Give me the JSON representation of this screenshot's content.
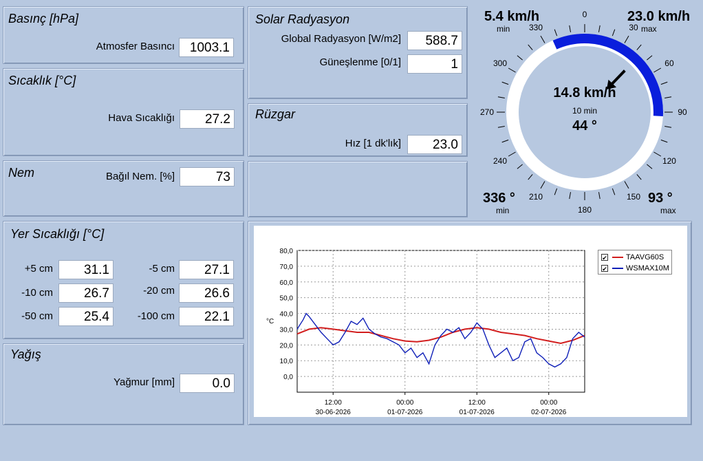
{
  "pressure": {
    "title": "Basınç [hPa]",
    "label": "Atmosfer Basıncı",
    "value": "1003.1"
  },
  "temperature": {
    "title": "Sıcaklık [°C]",
    "label": "Hava Sıcaklığı",
    "value": "27.2"
  },
  "humidity": {
    "title": "Nem",
    "label": "Bağıl Nem. [%]",
    "value": "73"
  },
  "soil": {
    "title": "Yer Sıcaklığı [°C]",
    "rows": [
      {
        "l_label": "+5 cm",
        "l_value": "31.1",
        "r_label": "-5 cm",
        "r_value": "27.1"
      },
      {
        "l_label": "-10 cm",
        "l_value": "26.7",
        "r_label": "-20 cm",
        "r_value": "26.6"
      },
      {
        "l_label": "-50 cm",
        "l_value": "25.4",
        "r_label": "-100 cm",
        "r_value": "22.1"
      }
    ]
  },
  "rain": {
    "title": "Yağış",
    "label": "Yağmur [mm]",
    "value": "0.0"
  },
  "solar": {
    "title": "Solar Radyasyon",
    "global_label": "Global Radyasyon [W/m2]",
    "global_value": "588.7",
    "sun_label": "Güneşlenme [0/1]",
    "sun_value": "1"
  },
  "wind": {
    "title": "Rüzgar",
    "label": "Hız [1 dk'lık]",
    "value": "23.0"
  },
  "gauge": {
    "min_speed": "5.4 km/h",
    "min_speed_label": "min",
    "max_speed": "23.0 km/h",
    "max_speed_label": "max",
    "center_speed": "14.8 km/h",
    "center_sub": "10 min",
    "center_dir": "44 °",
    "min_dir": "336 °",
    "min_dir_label": "min",
    "max_dir": "93 °",
    "max_dir_label": "max",
    "arrow_direction_deg": 44,
    "arc_from_deg": 336,
    "arc_to_deg": 93,
    "arc_color": "#0a1edc",
    "compass_labels": [
      "0",
      "30",
      "60",
      "90",
      "120",
      "150",
      "180",
      "210",
      "240",
      "270",
      "300",
      "330"
    ]
  },
  "chart_data": {
    "type": "line",
    "y_unit_label": "°C",
    "ylim": [
      -10,
      80
    ],
    "yticks": [
      "80,0",
      "70,0",
      "60,0",
      "50,0",
      "40,0",
      "30,0",
      "20,0",
      "10,0",
      "0,0"
    ],
    "xticks": [
      {
        "time": "12:00",
        "date": "30-06-2026"
      },
      {
        "time": "00:00",
        "date": "01-07-2026"
      },
      {
        "time": "12:00",
        "date": "01-07-2026"
      },
      {
        "time": "00:00",
        "date": "02-07-2026"
      }
    ],
    "grid": true,
    "legend_position": "top-right",
    "series": [
      {
        "name": "TAAVG60S",
        "color": "#d21e1e",
        "checked": true,
        "x": [
          0,
          2,
          4,
          6,
          8,
          10,
          12,
          14,
          16,
          18,
          20,
          22,
          24,
          26,
          28,
          30,
          32,
          34,
          36,
          38,
          40,
          42,
          44,
          46,
          48
        ],
        "values": [
          27,
          30,
          31,
          30,
          29,
          28,
          28,
          26,
          24,
          22.5,
          22,
          23,
          25,
          28,
          30,
          31,
          30,
          28,
          27,
          26,
          24,
          22.5,
          21,
          23,
          26
        ]
      },
      {
        "name": "WSMAX10M",
        "color": "#1020b8",
        "checked": true,
        "x": [
          0,
          1,
          1.5,
          2,
          3,
          4,
          5,
          6,
          7,
          8,
          9,
          10,
          11,
          12,
          13,
          14,
          15,
          16,
          17,
          18,
          19,
          20,
          21,
          22,
          23,
          24,
          25,
          26,
          27,
          28,
          29,
          30,
          31,
          32,
          33,
          34,
          35,
          36,
          37,
          38,
          39,
          40,
          41,
          42,
          43,
          44,
          45,
          46,
          47,
          48
        ],
        "values": [
          30,
          36,
          40,
          38,
          33,
          28,
          24,
          20,
          22,
          28,
          35,
          33,
          37,
          30,
          27,
          25,
          24,
          22,
          20,
          15,
          18,
          12,
          15,
          8,
          20,
          26,
          30,
          28,
          31,
          24,
          28,
          34,
          30,
          20,
          12,
          15,
          18,
          10,
          12,
          22,
          24,
          15,
          12,
          8,
          6,
          8,
          12,
          24,
          28,
          25
        ]
      }
    ]
  }
}
